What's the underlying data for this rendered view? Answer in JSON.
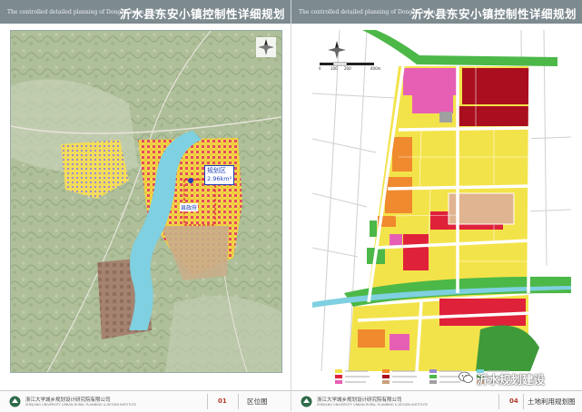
{
  "left_sheet": {
    "header_en": "The controlled detailed planning of DongAn town, Yishui",
    "header_cn": "沂水县东安小镇控制性详细规划",
    "map_labels": {
      "zone_label": "规划区",
      "area": "2.96km²",
      "center_label": "县政府"
    },
    "footer": {
      "org_cn": "浙江大学城乡规划设计研究院有限公司",
      "org_en": "ZHEJIANG UNIVERSITY URBAN-RURAL PLANNING & DESIGN INSTITUTE",
      "page_num": "01",
      "drawing_name": "区位图"
    }
  },
  "right_sheet": {
    "header_en": "The controlled detailed planning of DongAn town, Yishui",
    "header_cn": "沂水县东安小镇控制性详细规划",
    "scale": {
      "ticks": [
        "0",
        "100",
        "200",
        "400m"
      ]
    },
    "footer": {
      "org_cn": "浙江大学城乡规划设计研究院有限公司",
      "org_en": "ZHEJIANG UNIVERSITY URBAN-RURAL PLANNING & DESIGN INSTITUTE",
      "page_num": "04",
      "drawing_name": "土地利用规划图"
    }
  },
  "watermark": {
    "text": "沂水规划建设",
    "icon": "wechat-icon"
  },
  "colors": {
    "header": "#7d8a8f",
    "residential": "#f3e34a",
    "commercial": "#e0213a",
    "education": "#e65fb5",
    "green": "#4cb848",
    "water": "#7fd0e0",
    "road": "#ffffff",
    "industrial": "#c9a07a",
    "admin": "#f08a2e"
  }
}
